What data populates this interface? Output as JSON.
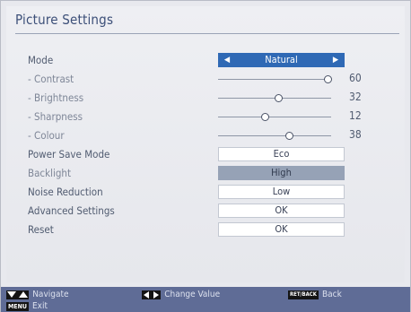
{
  "title": "Picture Settings",
  "mode": {
    "label": "Mode",
    "value": "Natural"
  },
  "sliders": [
    {
      "label": "- Contrast",
      "value": "60",
      "level": 0.97
    },
    {
      "label": "- Brightness",
      "value": "32",
      "level": 0.53
    },
    {
      "label": "- Sharpness",
      "value": "12",
      "level": 0.41
    },
    {
      "label": "- Colour",
      "value": "38",
      "level": 0.63
    }
  ],
  "options": [
    {
      "label": "Power Save Mode",
      "value": "Eco",
      "highlighted": false
    },
    {
      "label": "Backlight",
      "value": "High",
      "highlighted": true
    },
    {
      "label": "Noise Reduction",
      "value": "Low",
      "highlighted": false
    },
    {
      "label": "Advanced Settings",
      "value": "OK",
      "highlighted": false
    },
    {
      "label": "Reset",
      "value": "OK",
      "highlighted": false
    }
  ],
  "footer": {
    "navigate": "Navigate",
    "change_value": "Change Value",
    "retback_key": "RET/BACK",
    "back": "Back",
    "menu_key": "MENU",
    "exit": "Exit"
  },
  "colors": {
    "accent": "#2f69b5",
    "highlight": "#96a2b6",
    "footer": "#5f6c96"
  }
}
